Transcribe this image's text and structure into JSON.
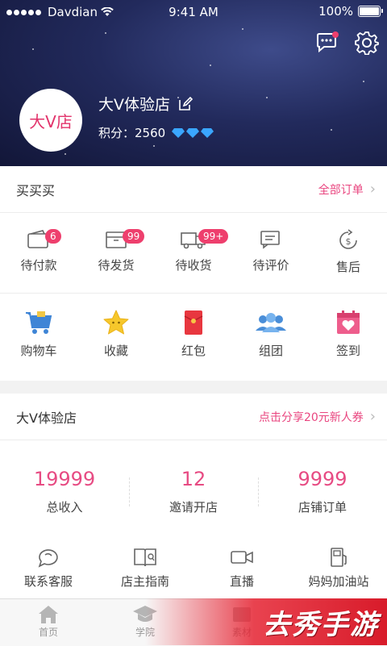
{
  "status_bar": {
    "carrier": "Davdian",
    "time": "9:41 AM",
    "battery": "100%"
  },
  "profile": {
    "avatar_text": "大V店",
    "shop_name": "大V体验店",
    "points_label": "积分：2560"
  },
  "orders": {
    "title": "买买买",
    "all_orders": "全部订单",
    "items": [
      {
        "label": "待付款",
        "badge": "6",
        "icon": "wallet-icon"
      },
      {
        "label": "待发货",
        "badge": "99",
        "icon": "box-icon"
      },
      {
        "label": "待收货",
        "badge": "99+",
        "icon": "truck-icon"
      },
      {
        "label": "待评价",
        "badge": "",
        "icon": "comment-icon"
      },
      {
        "label": "售后",
        "badge": "",
        "icon": "refund-icon"
      }
    ]
  },
  "shortcuts": [
    {
      "label": "购物车",
      "icon": "cart-icon"
    },
    {
      "label": "收藏",
      "icon": "star-icon"
    },
    {
      "label": "红包",
      "icon": "red-envelope-icon"
    },
    {
      "label": "组团",
      "icon": "group-icon"
    },
    {
      "label": "签到",
      "icon": "calendar-heart-icon"
    }
  ],
  "shop": {
    "title": "大V体验店",
    "share_link": "点击分享20元新人券",
    "stats": [
      {
        "value": "19999",
        "label": "总收入"
      },
      {
        "value": "12",
        "label": "邀请开店"
      },
      {
        "value": "9999",
        "label": "店铺订单"
      }
    ],
    "tools": [
      {
        "label": "联系客服",
        "icon": "service-icon"
      },
      {
        "label": "店主指南",
        "icon": "guide-icon"
      },
      {
        "label": "直播",
        "icon": "video-icon"
      },
      {
        "label": "妈妈加油站",
        "icon": "fuel-icon"
      }
    ]
  },
  "tabbar": {
    "items": [
      {
        "label": "首页"
      },
      {
        "label": "学院"
      },
      {
        "label": "素材"
      }
    ]
  },
  "watermark": "去秀手游",
  "colors": {
    "accent": "#e9457f",
    "badge": "#ee3f6d",
    "hero_bg": "#1b2150"
  }
}
